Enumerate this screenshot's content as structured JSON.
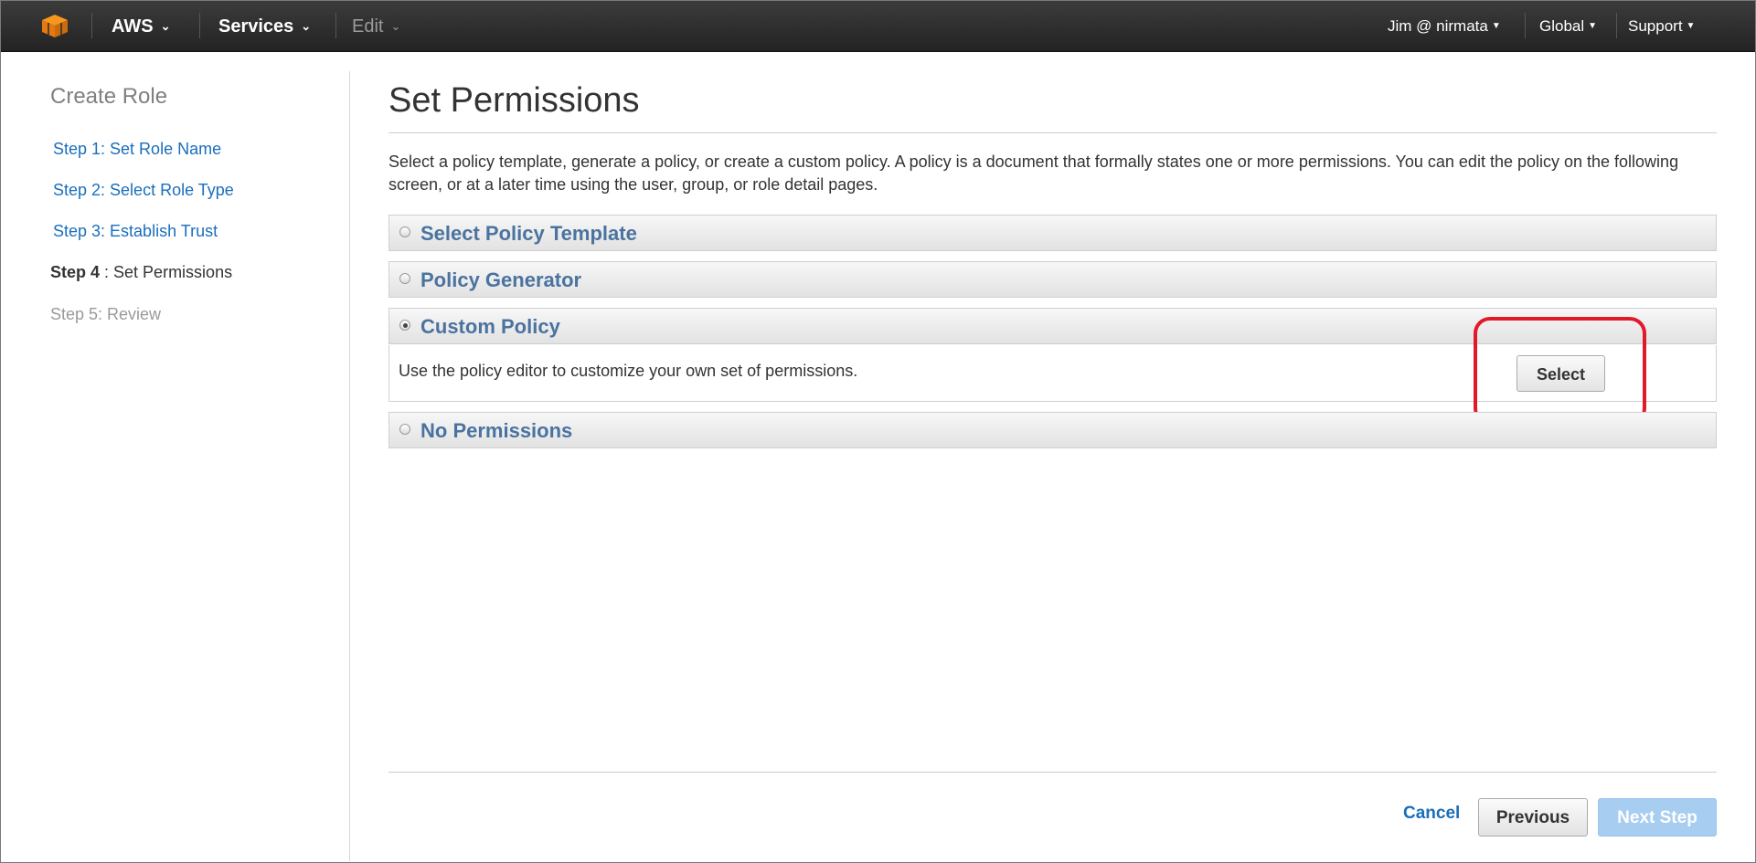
{
  "topnav": {
    "brand": "AWS",
    "services": "Services",
    "edit": "Edit",
    "user": "Jim @ nirmata",
    "region": "Global",
    "support": "Support"
  },
  "sidebar": {
    "title": "Create Role",
    "steps": [
      {
        "label": "Step 1: Set Role Name"
      },
      {
        "label": "Step 2: Select Role Type"
      },
      {
        "label": "Step 3: Establish Trust"
      },
      {
        "number": "Step 4",
        "rest": " : Set Permissions"
      },
      {
        "label": "Step 5: Review"
      }
    ]
  },
  "main": {
    "title": "Set Permissions",
    "intro": "Select a policy template, generate a policy, or create a custom policy. A policy is a document that formally states one or more permissions. You can edit the policy on the following screen, or at a later time using the user, group, or role detail pages.",
    "options": [
      {
        "label": "Select Policy Template",
        "selected": false
      },
      {
        "label": "Policy Generator",
        "selected": false
      },
      {
        "label": "Custom Policy",
        "selected": true
      },
      {
        "label": "No Permissions",
        "selected": false
      }
    ],
    "custom_description": "Use the policy editor to customize your own set of permissions.",
    "select_button": "Select"
  },
  "footer": {
    "cancel": "Cancel",
    "previous": "Previous",
    "next": "Next Step"
  },
  "colors": {
    "nav_bg": "#2b2b2b",
    "link": "#1a6ebc",
    "panel_label": "#4a73a0",
    "highlight": "#e11a2a",
    "next_disabled": "#a7cdf0",
    "logo": "#f7981d"
  }
}
